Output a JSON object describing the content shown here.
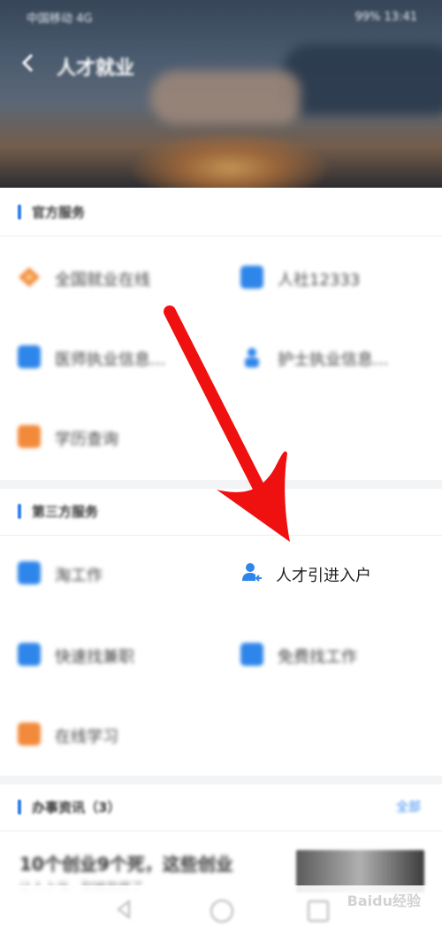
{
  "status_bar": {
    "left_text": "中国移动 4G",
    "right_text": "99% 13:41"
  },
  "header": {
    "title": "人才就业",
    "back_icon": "chevron-left-icon"
  },
  "sections": {
    "official": {
      "title": "官方服务",
      "items": [
        {
          "label": "全国就业在线",
          "icon": "diamond-logo-icon",
          "color": "#f28a3b"
        },
        {
          "label": "人社12333",
          "icon": "id-card-icon",
          "color": "#2f86ea"
        },
        {
          "label": "医师执业信息...",
          "icon": "medical-circle-icon",
          "color": "#2f86ea"
        },
        {
          "label": "护士执业信息...",
          "icon": "nurse-icon",
          "color": "#2f86ea"
        },
        {
          "label": "学历查询",
          "icon": "certificate-icon",
          "color": "#f28a3b"
        }
      ]
    },
    "third_party": {
      "title": "第三方服务",
      "items": [
        {
          "label": "淘工作",
          "icon": "document-edit-icon",
          "color": "#2f86ea"
        },
        {
          "label": "人才引进入户",
          "icon": "user-transfer-icon",
          "color": "#2f86ea"
        },
        {
          "label": "快速找兼职",
          "icon": "edit-card-icon",
          "color": "#2f86ea"
        },
        {
          "label": "免费找工作",
          "icon": "globe-chat-icon",
          "color": "#2f86ea"
        },
        {
          "label": "在线学习",
          "icon": "book-icon",
          "color": "#f28a3b"
        }
      ]
    },
    "news": {
      "title": "办事资讯（3）",
      "more_label": "全部",
      "headline": "10个创业9个死，这些创业",
      "subline": "让人上当，别被忽悠了"
    }
  },
  "bottom_nav": {
    "back": "triangle-back-icon",
    "home": "circle-home-icon",
    "recent": "square-recent-icon"
  },
  "watermark": "Baidu经验",
  "accent_color": "#2d7ff0"
}
